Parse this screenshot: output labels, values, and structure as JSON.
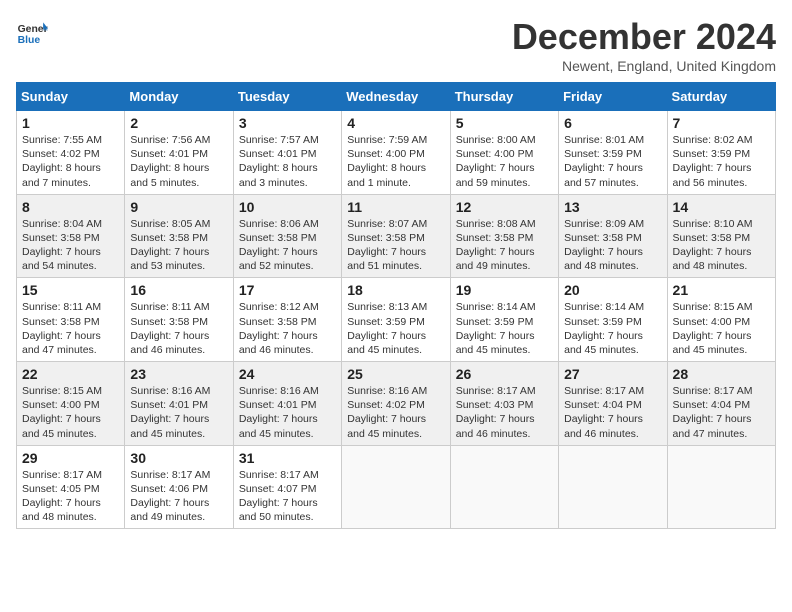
{
  "header": {
    "logo_line1": "General",
    "logo_line2": "Blue",
    "month_title": "December 2024",
    "location": "Newent, England, United Kingdom"
  },
  "weekdays": [
    "Sunday",
    "Monday",
    "Tuesday",
    "Wednesday",
    "Thursday",
    "Friday",
    "Saturday"
  ],
  "weeks": [
    [
      {
        "day": "1",
        "sunrise": "7:55 AM",
        "sunset": "4:02 PM",
        "daylight": "8 hours and 7 minutes."
      },
      {
        "day": "2",
        "sunrise": "7:56 AM",
        "sunset": "4:01 PM",
        "daylight": "8 hours and 5 minutes."
      },
      {
        "day": "3",
        "sunrise": "7:57 AM",
        "sunset": "4:01 PM",
        "daylight": "8 hours and 3 minutes."
      },
      {
        "day": "4",
        "sunrise": "7:59 AM",
        "sunset": "4:00 PM",
        "daylight": "8 hours and 1 minute."
      },
      {
        "day": "5",
        "sunrise": "8:00 AM",
        "sunset": "4:00 PM",
        "daylight": "7 hours and 59 minutes."
      },
      {
        "day": "6",
        "sunrise": "8:01 AM",
        "sunset": "3:59 PM",
        "daylight": "7 hours and 57 minutes."
      },
      {
        "day": "7",
        "sunrise": "8:02 AM",
        "sunset": "3:59 PM",
        "daylight": "7 hours and 56 minutes."
      }
    ],
    [
      {
        "day": "8",
        "sunrise": "8:04 AM",
        "sunset": "3:58 PM",
        "daylight": "7 hours and 54 minutes."
      },
      {
        "day": "9",
        "sunrise": "8:05 AM",
        "sunset": "3:58 PM",
        "daylight": "7 hours and 53 minutes."
      },
      {
        "day": "10",
        "sunrise": "8:06 AM",
        "sunset": "3:58 PM",
        "daylight": "7 hours and 52 minutes."
      },
      {
        "day": "11",
        "sunrise": "8:07 AM",
        "sunset": "3:58 PM",
        "daylight": "7 hours and 51 minutes."
      },
      {
        "day": "12",
        "sunrise": "8:08 AM",
        "sunset": "3:58 PM",
        "daylight": "7 hours and 49 minutes."
      },
      {
        "day": "13",
        "sunrise": "8:09 AM",
        "sunset": "3:58 PM",
        "daylight": "7 hours and 48 minutes."
      },
      {
        "day": "14",
        "sunrise": "8:10 AM",
        "sunset": "3:58 PM",
        "daylight": "7 hours and 48 minutes."
      }
    ],
    [
      {
        "day": "15",
        "sunrise": "8:11 AM",
        "sunset": "3:58 PM",
        "daylight": "7 hours and 47 minutes."
      },
      {
        "day": "16",
        "sunrise": "8:11 AM",
        "sunset": "3:58 PM",
        "daylight": "7 hours and 46 minutes."
      },
      {
        "day": "17",
        "sunrise": "8:12 AM",
        "sunset": "3:58 PM",
        "daylight": "7 hours and 46 minutes."
      },
      {
        "day": "18",
        "sunrise": "8:13 AM",
        "sunset": "3:59 PM",
        "daylight": "7 hours and 45 minutes."
      },
      {
        "day": "19",
        "sunrise": "8:14 AM",
        "sunset": "3:59 PM",
        "daylight": "7 hours and 45 minutes."
      },
      {
        "day": "20",
        "sunrise": "8:14 AM",
        "sunset": "3:59 PM",
        "daylight": "7 hours and 45 minutes."
      },
      {
        "day": "21",
        "sunrise": "8:15 AM",
        "sunset": "4:00 PM",
        "daylight": "7 hours and 45 minutes."
      }
    ],
    [
      {
        "day": "22",
        "sunrise": "8:15 AM",
        "sunset": "4:00 PM",
        "daylight": "7 hours and 45 minutes."
      },
      {
        "day": "23",
        "sunrise": "8:16 AM",
        "sunset": "4:01 PM",
        "daylight": "7 hours and 45 minutes."
      },
      {
        "day": "24",
        "sunrise": "8:16 AM",
        "sunset": "4:01 PM",
        "daylight": "7 hours and 45 minutes."
      },
      {
        "day": "25",
        "sunrise": "8:16 AM",
        "sunset": "4:02 PM",
        "daylight": "7 hours and 45 minutes."
      },
      {
        "day": "26",
        "sunrise": "8:17 AM",
        "sunset": "4:03 PM",
        "daylight": "7 hours and 46 minutes."
      },
      {
        "day": "27",
        "sunrise": "8:17 AM",
        "sunset": "4:04 PM",
        "daylight": "7 hours and 46 minutes."
      },
      {
        "day": "28",
        "sunrise": "8:17 AM",
        "sunset": "4:04 PM",
        "daylight": "7 hours and 47 minutes."
      }
    ],
    [
      {
        "day": "29",
        "sunrise": "8:17 AM",
        "sunset": "4:05 PM",
        "daylight": "7 hours and 48 minutes."
      },
      {
        "day": "30",
        "sunrise": "8:17 AM",
        "sunset": "4:06 PM",
        "daylight": "7 hours and 49 minutes."
      },
      {
        "day": "31",
        "sunrise": "8:17 AM",
        "sunset": "4:07 PM",
        "daylight": "7 hours and 50 minutes."
      },
      null,
      null,
      null,
      null
    ]
  ]
}
